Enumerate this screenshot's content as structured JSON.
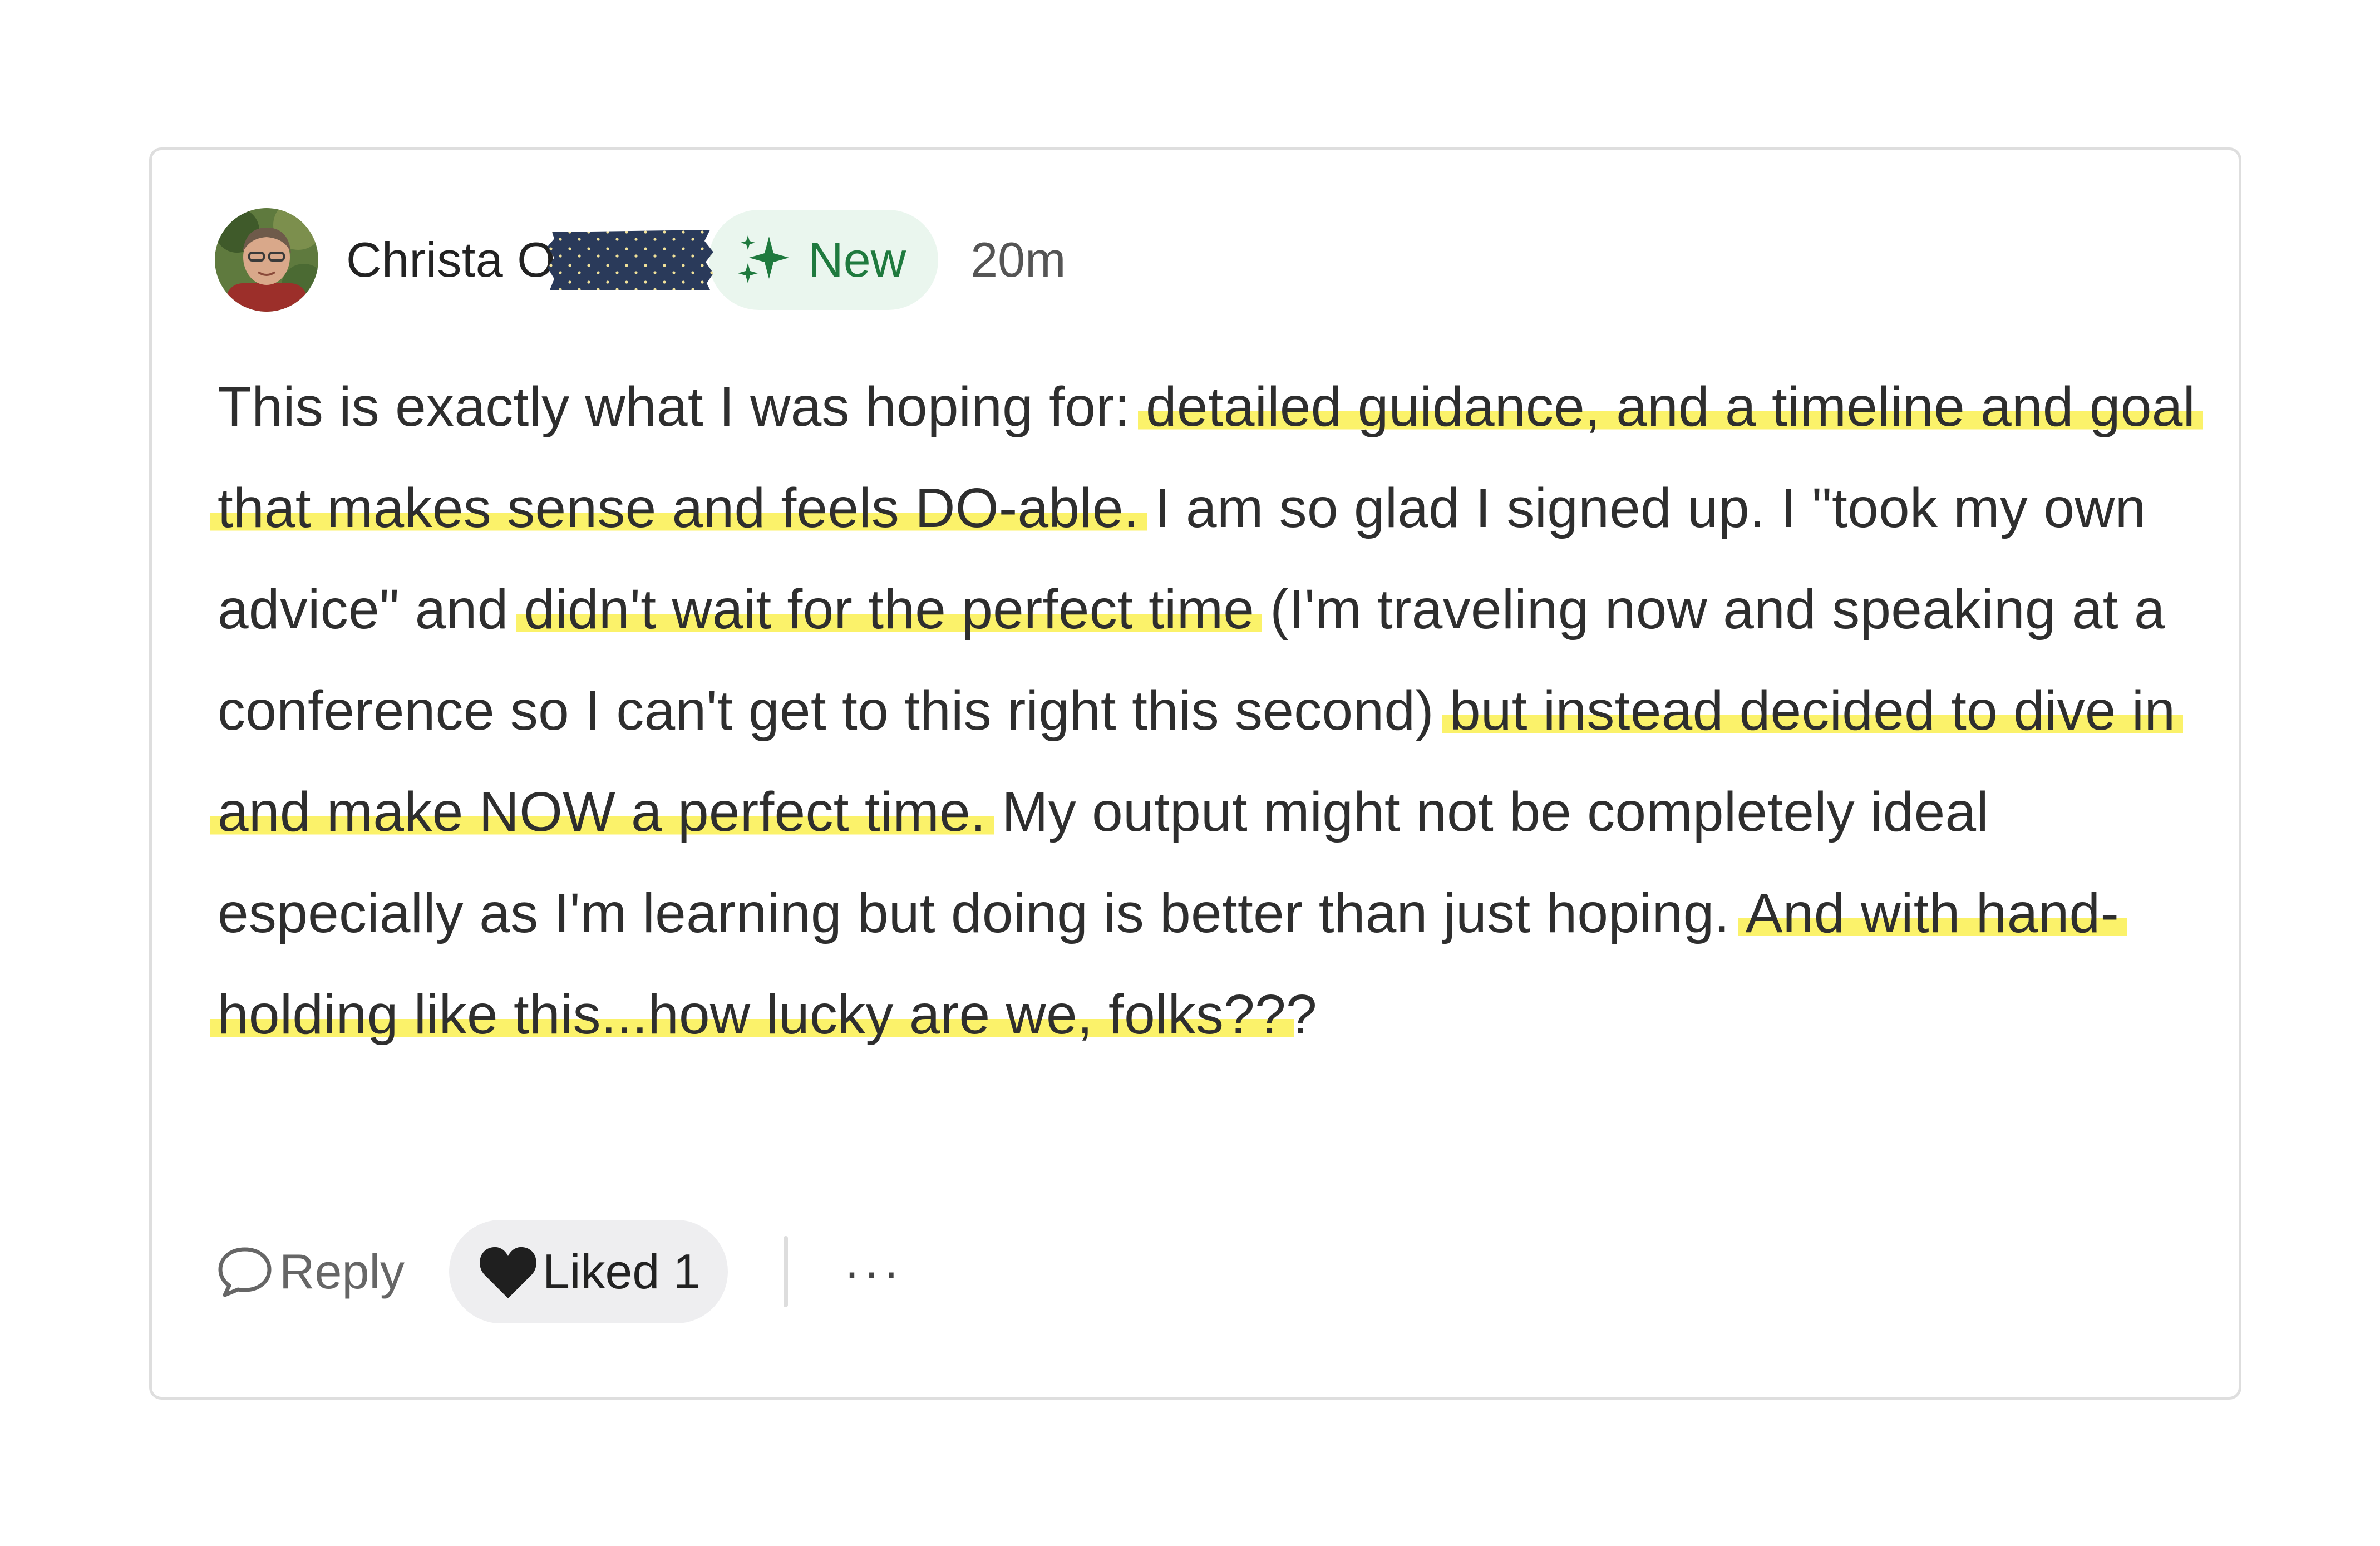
{
  "comment": {
    "author": "Christa O",
    "badge": "New",
    "timestamp": "20m",
    "body": [
      {
        "text": "This is exactly what I was hoping for: ",
        "highlight": false
      },
      {
        "text": "detailed guidance, and a timeline and goal that makes sense and feels DO-able.",
        "highlight": true
      },
      {
        "text": " I am so glad I signed up. I \"took my own advice\" and ",
        "highlight": false
      },
      {
        "text": "didn't wait for the perfect time",
        "highlight": true
      },
      {
        "text": " (I'm traveling now and speaking at a conference so I can't get to this right this second) ",
        "highlight": false
      },
      {
        "text": "but instead decided to dive in and make NOW a perfect time.",
        "highlight": true
      },
      {
        "text": " My output might not be completely ideal especially as I'm learning but doing is better than just hoping. ",
        "highlight": false
      },
      {
        "text": "And with hand-holding like this...how lucky are we, folks??",
        "highlight": true
      },
      {
        "text": "?",
        "highlight": false
      }
    ],
    "highlight_color": "#fbf26a"
  },
  "actions": {
    "reply_label": "Reply",
    "liked_label": "Liked",
    "liked_count": "1",
    "more_label": "···"
  },
  "icons": {
    "avatar": "avatar",
    "sparkle": "sparkle-icon",
    "reply": "speech-bubble-icon",
    "heart": "heart-icon"
  },
  "colors": {
    "badge_bg": "#eaf6ee",
    "badge_text": "#1f7a3e",
    "liked_bg": "#eeeef0",
    "redaction_bg": "#2a3a5a"
  }
}
